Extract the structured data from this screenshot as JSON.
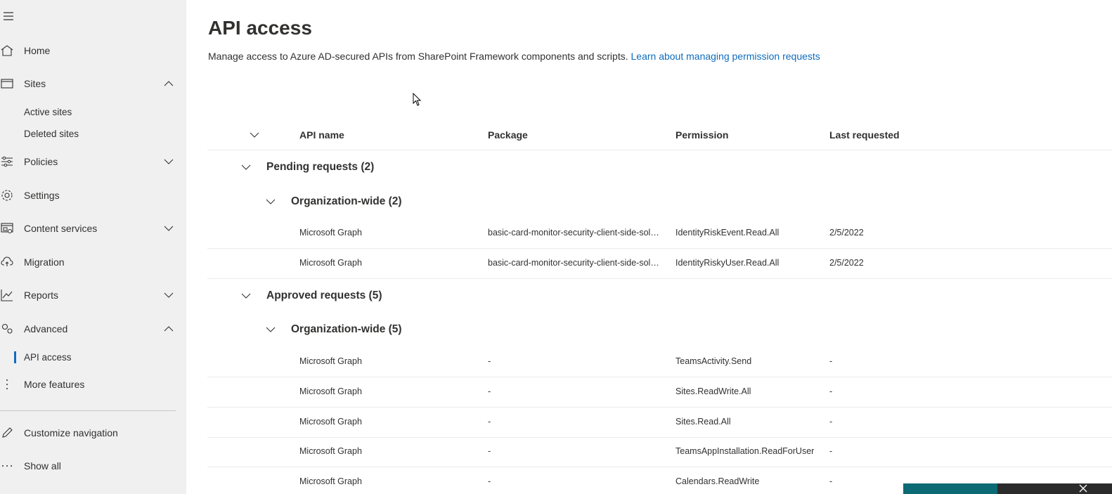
{
  "sidebar": {
    "home": "Home",
    "sites": "Sites",
    "active_sites": "Active sites",
    "deleted_sites": "Deleted sites",
    "policies": "Policies",
    "settings": "Settings",
    "content_services": "Content services",
    "migration": "Migration",
    "reports": "Reports",
    "advanced": "Advanced",
    "api_access": "API access",
    "more_features": "More features",
    "customize_navigation": "Customize navigation",
    "show_all": "Show all"
  },
  "page": {
    "title": "API access",
    "description": "Manage access to Azure AD-secured APIs from SharePoint Framework components and scripts.",
    "learn_link": "Learn about managing permission requests"
  },
  "table": {
    "columns": [
      "API name",
      "Package",
      "Permission",
      "Last requested"
    ],
    "pending": {
      "label": "Pending requests (2)",
      "org_label": "Organization-wide (2)",
      "rows": [
        [
          "Microsoft Graph",
          "basic-card-monitor-security-client-side-soluti...",
          "IdentityRiskEvent.Read.All",
          "2/5/2022"
        ],
        [
          "Microsoft Graph",
          "basic-card-monitor-security-client-side-soluti...",
          "IdentityRiskyUser.Read.All",
          "2/5/2022"
        ]
      ]
    },
    "approved": {
      "label": "Approved requests (5)",
      "org_label": "Organization-wide (5)",
      "rows": [
        [
          "Microsoft Graph",
          "-",
          "TeamsActivity.Send",
          "-"
        ],
        [
          "Microsoft Graph",
          "-",
          "Sites.ReadWrite.All",
          "-"
        ],
        [
          "Microsoft Graph",
          "-",
          "Sites.Read.All",
          "-"
        ],
        [
          "Microsoft Graph",
          "-",
          "TeamsAppInstallation.ReadForUser",
          "-"
        ],
        [
          "Microsoft Graph",
          "-",
          "Calendars.ReadWrite",
          "-"
        ]
      ]
    }
  },
  "colors": {
    "sidebar_bg": "#f0f0f0",
    "link": "#0f6cbd",
    "active_indicator": "#0f6cbd",
    "text": "#323130",
    "toast_teal": "#0b6a73"
  },
  "icons": {
    "menu": "hamburger-icon",
    "home": "home-icon",
    "sites": "sites-icon",
    "policies": "policies-icon",
    "settings": "gear-icon",
    "content_services": "content-services-icon",
    "migration": "cloud-upload-icon",
    "reports": "chart-icon",
    "advanced": "gears-icon",
    "more": "more-vertical-icon",
    "customize": "pencil-icon",
    "show_all": "ellipsis-icon"
  }
}
